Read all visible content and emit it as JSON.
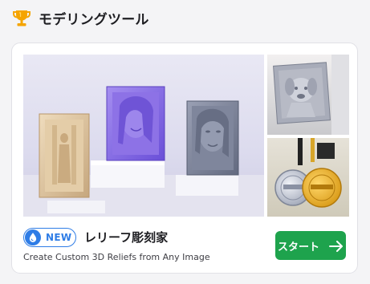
{
  "section": {
    "title": "モデリングツール",
    "icon": "trophy-icon",
    "icon_color": "#f5a400"
  },
  "card": {
    "images": [
      {
        "name": "main-image",
        "alt": "relief-display-photo"
      },
      {
        "name": "dog-relief-image",
        "alt": "dog-relief-photo"
      },
      {
        "name": "medal-relief-image",
        "alt": "medal-relief-photo"
      }
    ],
    "badge": {
      "label": "NEW",
      "icon": "water-drop-icon",
      "color": "#2f7de6"
    },
    "product_name": "レリーフ彫刻家",
    "product_subtitle": "Create Custom 3D Reliefs from Any Image",
    "start_button": {
      "label": "スタート",
      "icon": "arrow-right-icon",
      "color": "#1ea34d"
    }
  }
}
